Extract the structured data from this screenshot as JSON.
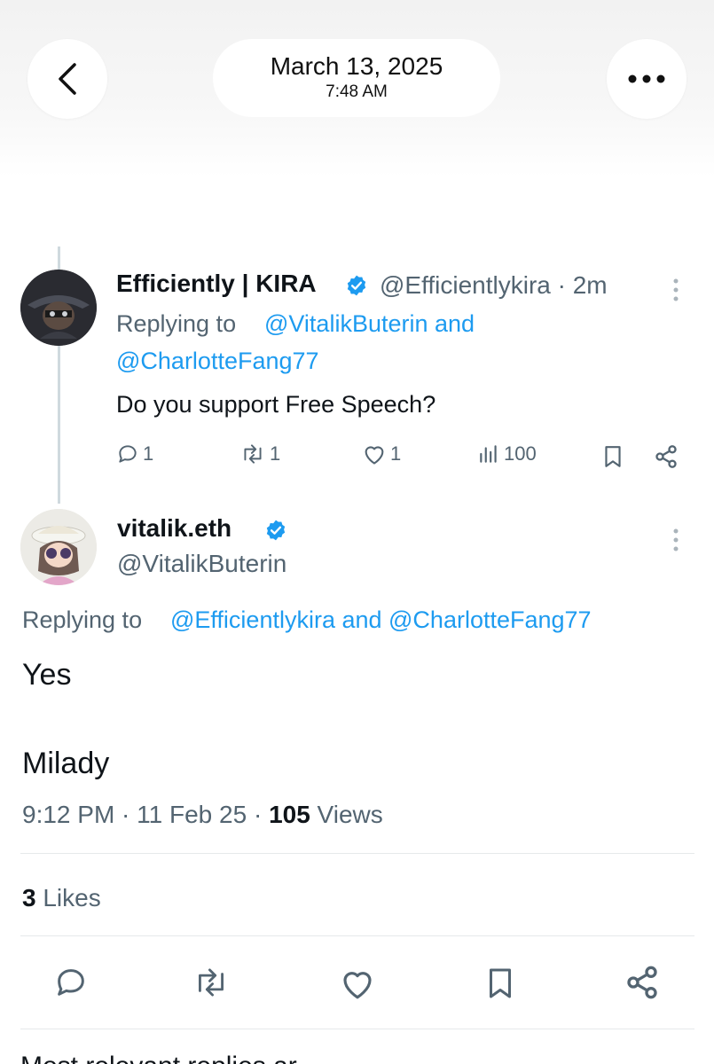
{
  "header": {
    "date": "March 13, 2025",
    "time": "7:48 AM",
    "back_icon": "chevron-left-icon",
    "more_icon": "more-horizontal-icon"
  },
  "parent_tweet": {
    "display_name": "Efficiently | KIRA",
    "handle_time": "@Efficientlykira · 2m",
    "replying_prefix": "Replying to",
    "replying_to_1": "@VitalikButerin and",
    "replying_to_2": "@CharlotteFang77",
    "text": "Do you support Free Speech?",
    "replies": "1",
    "reposts": "1",
    "likes": "1",
    "views": "100"
  },
  "main_tweet": {
    "display_name": "vitalik.eth",
    "handle": "@VitalikButerin",
    "replying_prefix": "Replying to",
    "replying_to": "@Efficientlykira and @CharlotteFang77",
    "line1": "Yes",
    "line2": "Milady",
    "timestamp": "9:12 PM · 11 Feb 25 · ",
    "views_count": "105",
    "views_label": " Views",
    "likes_count": "3",
    "likes_label": " Likes"
  },
  "footer": {
    "cutoff_text": "Most relevant replies ar"
  },
  "colors": {
    "link": "#1d9bf0",
    "muted": "#536471",
    "verified": "#1d9bf0"
  }
}
